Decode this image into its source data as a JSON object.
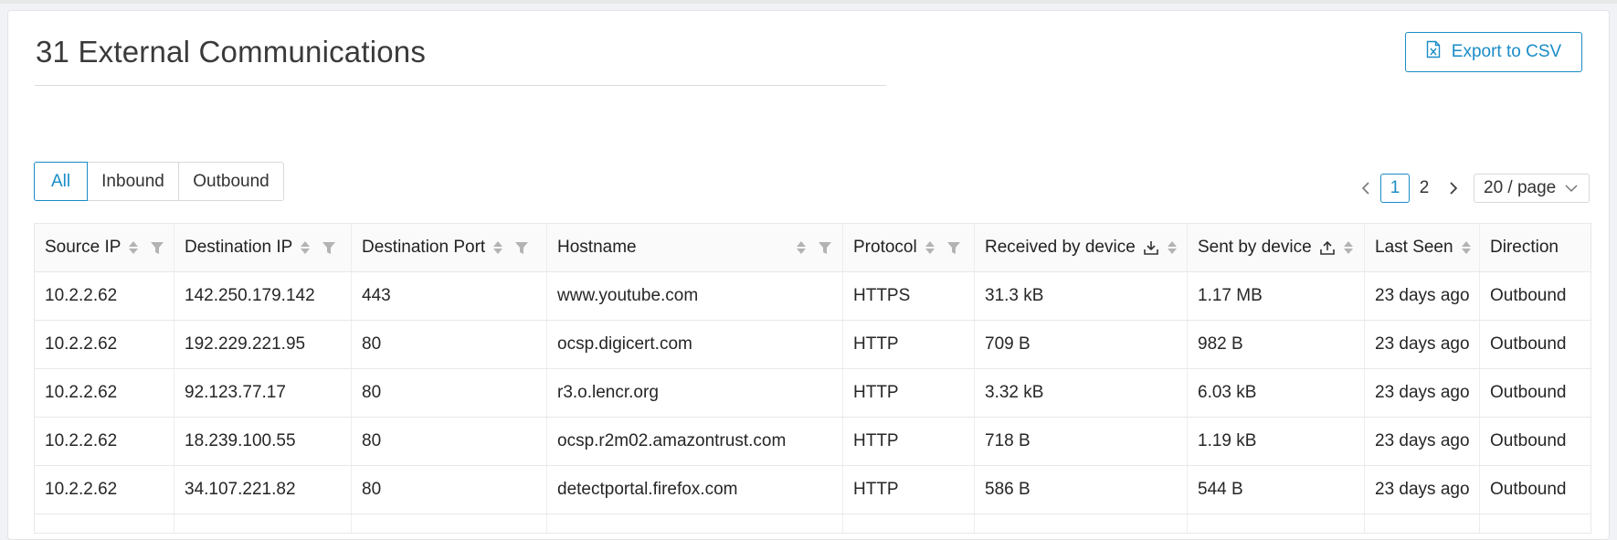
{
  "page": {
    "title": "31 External Communications",
    "export_label": "Export to CSV"
  },
  "filters": {
    "tabs": [
      {
        "label": "All",
        "active": true
      },
      {
        "label": "Inbound",
        "active": false
      },
      {
        "label": "Outbound",
        "active": false
      }
    ]
  },
  "pagination": {
    "pages": [
      "1",
      "2"
    ],
    "current": "1",
    "page_size": "20 / page"
  },
  "table": {
    "columns": [
      "Source IP",
      "Destination IP",
      "Destination Port",
      "Hostname",
      "Protocol",
      "Received by device",
      "Sent by device",
      "Last Seen",
      "Direction"
    ],
    "rows": [
      [
        "10.2.2.62",
        "142.250.179.142",
        "443",
        "www.youtube.com",
        "HTTPS",
        "31.3 kB",
        "1.17 MB",
        "23 days ago",
        "Outbound"
      ],
      [
        "10.2.2.62",
        "192.229.221.95",
        "80",
        "ocsp.digicert.com",
        "HTTP",
        "709 B",
        "982 B",
        "23 days ago",
        "Outbound"
      ],
      [
        "10.2.2.62",
        "92.123.77.17",
        "80",
        "r3.o.lencr.org",
        "HTTP",
        "3.32 kB",
        "6.03 kB",
        "23 days ago",
        "Outbound"
      ],
      [
        "10.2.2.62",
        "18.239.100.55",
        "80",
        "ocsp.r2m02.amazontrust.com",
        "HTTP",
        "718 B",
        "1.19 kB",
        "23 days ago",
        "Outbound"
      ],
      [
        "10.2.2.62",
        "34.107.221.82",
        "80",
        "detectportal.firefox.com",
        "HTTP",
        "586 B",
        "544 B",
        "23 days ago",
        "Outbound"
      ]
    ]
  },
  "colors": {
    "accent": "#1a8cc7",
    "border": "#e8e8e8",
    "header_bg": "#fafafa"
  },
  "icons": {
    "export": "csv-file-icon",
    "received": "download-icon",
    "sent": "upload-icon",
    "sort": "sort-icon",
    "filter": "filter-icon",
    "prev": "chevron-left-icon",
    "next": "chevron-right-icon",
    "dropdown": "chevron-down-icon"
  }
}
